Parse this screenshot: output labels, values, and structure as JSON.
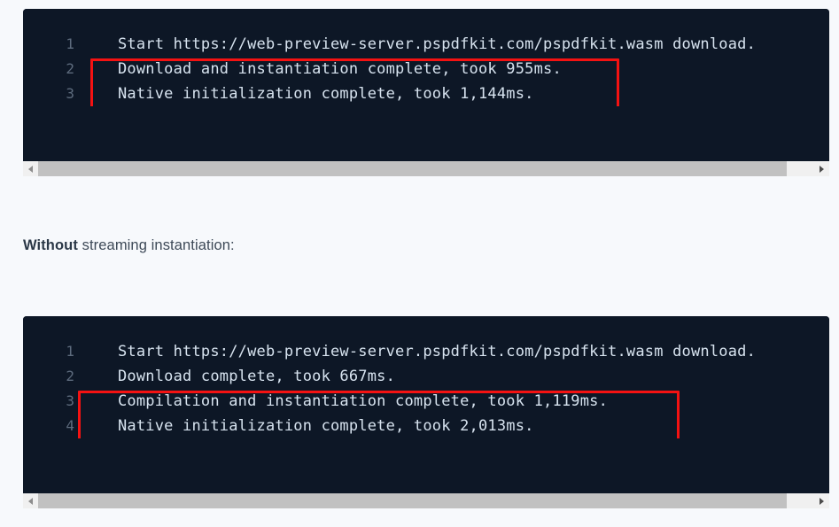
{
  "page": {
    "background_color": "#f7f9fc",
    "code_background_color": "#0d1726",
    "code_text_color": "#d7e3ef",
    "line_number_color": "#5d6b7d",
    "highlight_color": "#f41212",
    "caption_color": "#3d4957"
  },
  "block1": {
    "name": "with-streaming-instantiation-console-output",
    "lines": [
      {
        "number": "1",
        "text": "Start https://web-preview-server.pspdfkit.com/pspdfkit.wasm download."
      },
      {
        "number": "2",
        "text": "Download and instantiation complete, took 955ms."
      },
      {
        "number": "3",
        "text": "Native initialization complete, took 1,144ms."
      }
    ],
    "copy_icon": "copy-icon",
    "scrollbar": {
      "left_arrow": "scroll-left-arrow-icon",
      "right_arrow": "scroll-right-arrow-icon",
      "thumb_left_pct": "0",
      "thumb_width_pct": "96.5"
    }
  },
  "caption": {
    "emphasis": "Without",
    "rest": " streaming instantiation:"
  },
  "block2": {
    "name": "without-streaming-instantiation-console-output",
    "lines": [
      {
        "number": "1",
        "text": "Start https://web-preview-server.pspdfkit.com/pspdfkit.wasm download."
      },
      {
        "number": "2",
        "text": "Download complete, took 667ms."
      },
      {
        "number": "3",
        "text": "Compilation and instantiation complete, took 1,119ms."
      },
      {
        "number": "4",
        "text": "Native initialization complete, took 2,013ms."
      }
    ],
    "copy_icon": "copy-icon",
    "scrollbar": {
      "left_arrow": "scroll-left-arrow-icon",
      "right_arrow": "scroll-right-arrow-icon",
      "thumb_left_pct": "0",
      "thumb_width_pct": "96.5"
    }
  }
}
